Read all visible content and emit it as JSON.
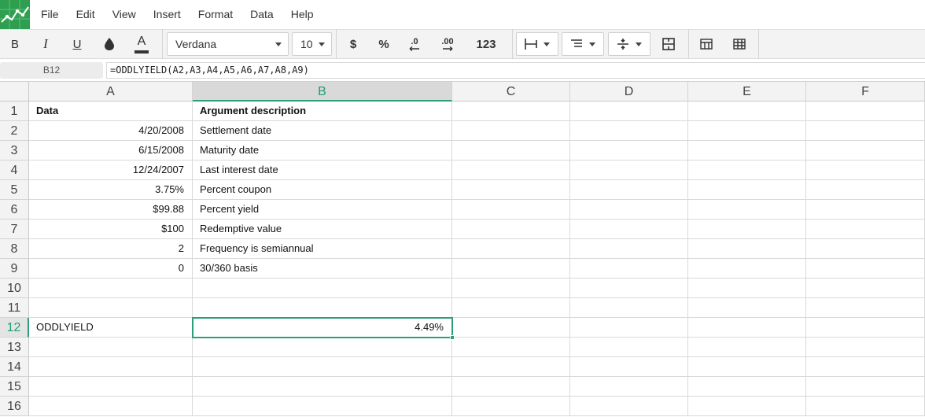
{
  "menu": {
    "items": [
      "File",
      "Edit",
      "View",
      "Insert",
      "Format",
      "Data",
      "Help"
    ]
  },
  "toolbar": {
    "bold_label": "B",
    "italic_label": "I",
    "underline_label": "U",
    "text_color_label": "A",
    "font_name": "Verdana",
    "font_size": "10",
    "currency_label": "$",
    "percent_label": "%",
    "decrease_decimals_label": ".0",
    "increase_decimals_label": ".00",
    "number_format_label": "123"
  },
  "formula_bar": {
    "cell_ref": "B12",
    "formula": "=ODDLYIELD(A2,A3,A4,A5,A6,A7,A8,A9)"
  },
  "grid": {
    "columns": [
      "A",
      "B",
      "C",
      "D",
      "E",
      "F"
    ],
    "rows": [
      "1",
      "2",
      "3",
      "4",
      "5",
      "6",
      "7",
      "8",
      "9",
      "10",
      "11",
      "12",
      "13",
      "14",
      "15",
      "16"
    ],
    "cells": {
      "A1": "Data",
      "B1": "Argument description",
      "A2": "4/20/2008",
      "B2": "Settlement date",
      "A3": "6/15/2008",
      "B3": "Maturity date",
      "A4": "12/24/2007",
      "B4": "Last interest date",
      "A5": "3.75%",
      "B5": "Percent coupon",
      "A6": "$99.88",
      "B6": "Percent yield",
      "A7": "$100",
      "B7": "Redemptive value",
      "A8": "2",
      "B8": "Frequency is semiannual",
      "A9": "0",
      "B9": "30/360 basis",
      "A12": "ODDLYIELD",
      "B12": "4.49%"
    }
  },
  "colors": {
    "accent": "#2e9e75",
    "logo_bg": "#2e9e50"
  }
}
